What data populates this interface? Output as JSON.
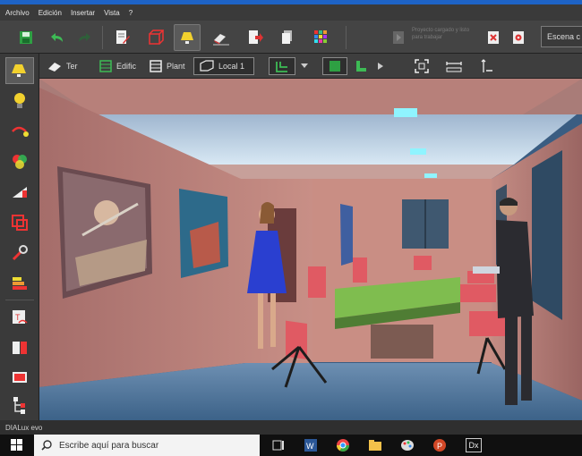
{
  "menu": [
    "Archivo",
    "Edición",
    "Insertar",
    "Vista",
    "?"
  ],
  "toolbar": {
    "save": "save-icon",
    "undo": "undo-icon",
    "redo": "redo-icon",
    "disabled_text": "Proyecto cargado y listo para trabajar",
    "scene_label": "Escena c"
  },
  "toolbar2": {
    "terrain_label": "Ter",
    "building_label": "Edific",
    "plan_label": "Plant",
    "local_label": "Local 1"
  },
  "status": {
    "text": "DIALux evo"
  },
  "taskbar": {
    "search_placeholder": "Escribe aquí para buscar",
    "dx_label": "Dx"
  },
  "colors": {
    "accent": "#1e63c6",
    "toolbar": "#444444",
    "sidebar": "#3a3a3a"
  }
}
